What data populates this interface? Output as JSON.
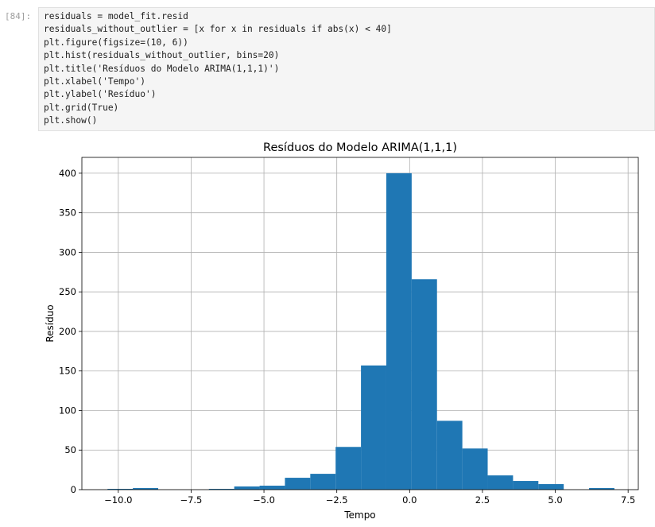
{
  "cell": {
    "prompt": "[84]:",
    "code_lines": [
      "residuals = model_fit.resid",
      "residuals_without_outlier = [x for x in residuals if abs(x) < 40]",
      "plt.figure(figsize=(10, 6))",
      "plt.hist(residuals_without_outlier, bins=20)",
      "plt.title('Resíduos do Modelo ARIMA(1,1,1)')",
      "plt.xlabel('Tempo')",
      "plt.ylabel('Resíduo')",
      "plt.grid(True)",
      "plt.show()"
    ]
  },
  "chart_data": {
    "type": "bar",
    "title": "Resíduos do Modelo ARIMA(1,1,1)",
    "xlabel": "Tempo",
    "ylabel": "Resíduo",
    "grid": true,
    "xlim": [
      -11.25,
      7.85
    ],
    "ylim": [
      0,
      420
    ],
    "xticks": [
      -10.0,
      -7.5,
      -5.0,
      -2.5,
      0.0,
      2.5,
      5.0,
      7.5
    ],
    "xtick_labels": [
      "−10.0",
      "−7.5",
      "−5.0",
      "−2.5",
      "0.0",
      "2.5",
      "5.0",
      "7.5"
    ],
    "yticks": [
      0,
      50,
      100,
      150,
      200,
      250,
      300,
      350,
      400
    ],
    "ytick_labels": [
      "0",
      "50",
      "100",
      "150",
      "200",
      "250",
      "300",
      "350",
      "400"
    ],
    "bar_color": "#1f77b4",
    "bins": [
      {
        "x0": -10.37,
        "x1": -9.5,
        "count": 1
      },
      {
        "x0": -9.5,
        "x1": -8.63,
        "count": 2
      },
      {
        "x0": -8.63,
        "x1": -7.76,
        "count": 0
      },
      {
        "x0": -7.76,
        "x1": -6.89,
        "count": 0
      },
      {
        "x0": -6.89,
        "x1": -6.02,
        "count": 1
      },
      {
        "x0": -6.02,
        "x1": -5.15,
        "count": 4
      },
      {
        "x0": -5.15,
        "x1": -4.28,
        "count": 5
      },
      {
        "x0": -4.28,
        "x1": -3.41,
        "count": 15
      },
      {
        "x0": -3.41,
        "x1": -2.54,
        "count": 20
      },
      {
        "x0": -2.54,
        "x1": -1.67,
        "count": 54
      },
      {
        "x0": -1.67,
        "x1": -0.8,
        "count": 157
      },
      {
        "x0": -0.8,
        "x1": 0.07,
        "count": 400
      },
      {
        "x0": 0.07,
        "x1": 0.94,
        "count": 266
      },
      {
        "x0": 0.94,
        "x1": 1.81,
        "count": 87
      },
      {
        "x0": 1.81,
        "x1": 2.68,
        "count": 52
      },
      {
        "x0": 2.68,
        "x1": 3.55,
        "count": 18
      },
      {
        "x0": 3.55,
        "x1": 4.42,
        "count": 11
      },
      {
        "x0": 4.42,
        "x1": 5.29,
        "count": 7
      },
      {
        "x0": 5.29,
        "x1": 6.16,
        "count": 0
      },
      {
        "x0": 6.16,
        "x1": 7.03,
        "count": 2
      }
    ]
  }
}
